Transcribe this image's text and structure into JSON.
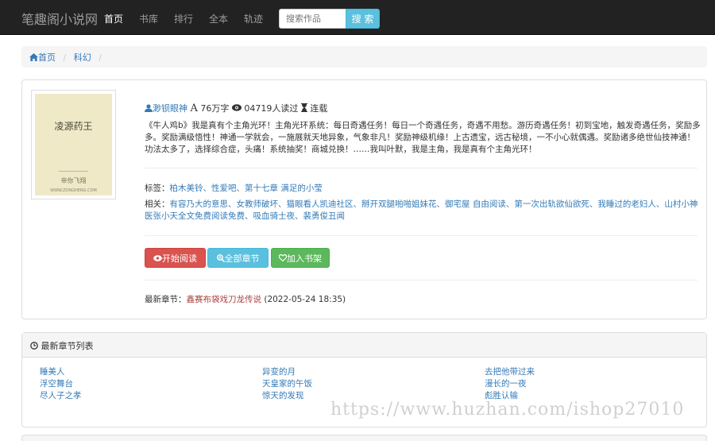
{
  "navbar": {
    "brand": "笔趣阁小说网",
    "items": [
      {
        "label": "首页",
        "active": true
      },
      {
        "label": "书库",
        "active": false
      },
      {
        "label": "排行",
        "active": false
      },
      {
        "label": "全本",
        "active": false
      },
      {
        "label": "轨迹",
        "active": false
      }
    ],
    "search_placeholder": "搜索作品",
    "search_label": "搜 索"
  },
  "breadcrumb": {
    "home": "首页",
    "category": "科幻"
  },
  "book": {
    "cover_title": "凌源药王",
    "cover_author": "帝你飞翔",
    "cover_site": "WWW.ZONGHENG.COM",
    "author": "渺钡眼神",
    "word_count": "76万字",
    "reads": "04719人读过",
    "status": "连载",
    "intro": "《牛人鸡b》我是真有个主角光环！主角光环系统：每日奇遇任务！每日一个奇遇任务，奇遇不用愁。游历奇遇任务！初到宝地，触发奇遇任务，奖励多多。奖励满级悟性！神通一学就会，一施展就天地异象，气象非凡！奖励神级机缘！上古遗宝，远古秘境，一不小心就偶遇。奖励诸多绝世仙技神通！功法太多了，选择综合症，头痛！系统抽奖！商城兑换！……我叫叶默，我是主角，我是真有个主角光环！",
    "tags_label": "标签：",
    "tags": "柏木美铃、性爱吧、第十七章 满足的小莹",
    "related_label": "相关：",
    "related": "有容乃大的意思、女教师破坏、猫眼看人凯迪社区、掰开双腿啪啪姐妹花、御宅屋 自由阅读、第一次出轨欲仙欲死、我睡过的老妇人、山村小神医张小天全文免费阅读免费、吸血骑士夜、裴勇俊丑闻",
    "btn_read": "开始阅读",
    "btn_chapters": "全部章节",
    "btn_shelf": "加入书架",
    "latest_label": "最新章节：",
    "latest_chapter": "鑫赛布袋戏刀龙传说",
    "latest_time": "(2022-05-24 18:35)"
  },
  "chapters": {
    "title": "最新章节列表",
    "columns": [
      [
        "睡美人",
        "浮空舞台",
        "尽人子之孝"
      ],
      [
        "异变的月",
        "天皇家的午饭",
        "惊天的发现"
      ],
      [
        "去把他带过来",
        "漫长的一夜",
        "彪胜认输"
      ]
    ]
  },
  "watermark": "https://www.huzhan.com/ishop27010",
  "colors": {
    "navbar_bg": "#222222",
    "link": "#337ab7",
    "danger": "#d9534f",
    "info": "#5bc0de",
    "success": "#5cb85c"
  }
}
